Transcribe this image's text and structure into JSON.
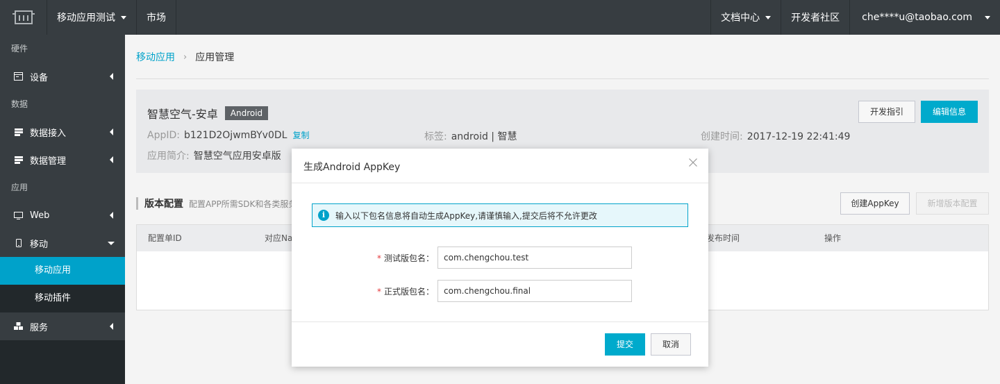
{
  "topbar": {
    "app_menu": "移动应用测试",
    "market": "市场",
    "docs": "文档中心",
    "community": "开发者社区",
    "user": "che****u@taobao.com"
  },
  "sidebar": {
    "groups": {
      "hardware": "硬件",
      "data": "数据",
      "app": "应用"
    },
    "items": {
      "device": "设备",
      "data_access": "数据接入",
      "data_manage": "数据管理",
      "web": "Web",
      "mobile": "移动",
      "mobile_app": "移动应用",
      "mobile_plugin": "移动插件",
      "service": "服务"
    }
  },
  "breadcrumb": {
    "parent": "移动应用",
    "current": "应用管理"
  },
  "app": {
    "name": "智慧空气-安卓",
    "platform": "Android",
    "appid_label": "AppID:",
    "appid_value": "b121D2OjwmBYv0DL",
    "copy": "复制",
    "tag_label": "标签:",
    "tag_value": "android | 智慧",
    "created_label": "创建时间:",
    "created_value": "2017-12-19 22:41:49",
    "desc_label": "应用简介:",
    "desc_value": "智慧空气应用安卓版",
    "btn_guide": "开发指引",
    "btn_edit": "编辑信息"
  },
  "section": {
    "title": "版本配置",
    "desc": "配置APP所需SDK和各类服务",
    "btn_create_appkey": "创建AppKey",
    "btn_new_version": "新增版本配置"
  },
  "table": {
    "headers": [
      "配置单ID",
      "对应Na",
      "发布时间",
      "操作"
    ]
  },
  "modal": {
    "title": "生成Android AppKey",
    "alert": "输入以下包名信息将自动生成AppKey,请谨慎输入,提交后将不允许更改",
    "test_label": "测试版包名：",
    "test_value": "com.chengchou.test",
    "prod_label": "正式版包名：",
    "prod_value": "com.chengchou.final",
    "required_mark": "*",
    "submit": "提交",
    "cancel": "取消"
  },
  "colors": {
    "accent": "#00a2ca",
    "topbar": "#373d41",
    "sidebar_dark": "#22282b"
  }
}
